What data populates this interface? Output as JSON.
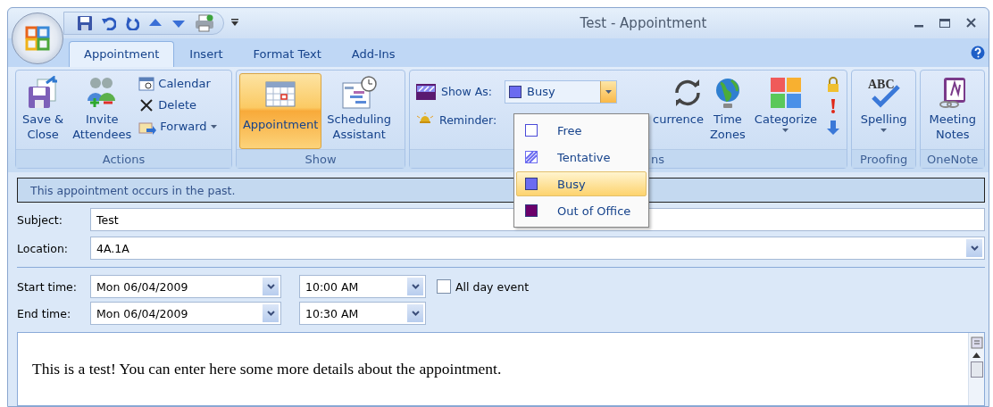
{
  "title_bar": {
    "title": "Test - Appointment"
  },
  "tabs": [
    {
      "label": "Appointment",
      "selected": true
    },
    {
      "label": "Insert",
      "selected": false
    },
    {
      "label": "Format Text",
      "selected": false
    },
    {
      "label": "Add-Ins",
      "selected": false
    }
  ],
  "ribbon": {
    "actions": {
      "label": "Actions",
      "save_close": [
        "Save &",
        "Close"
      ],
      "invite_attendees": [
        "Invite",
        "Attendees"
      ],
      "calendar": "Calendar",
      "delete": "Delete",
      "forward": "Forward"
    },
    "show": {
      "label": "Show",
      "appointment": {
        "label": "Appointment",
        "selected": true
      },
      "scheduling_assistant": [
        "Scheduling",
        "Assistant"
      ]
    },
    "options": {
      "label": "ns",
      "show_as_label": "Show As:",
      "show_as_value": "Busy",
      "reminder_label": "Reminder:",
      "recurrence": "currence",
      "time_zones": [
        "Time",
        "Zones"
      ],
      "categorize": "Categorize"
    },
    "proofing": {
      "label": "Proofing",
      "spelling": "Spelling",
      "spelling_icon_text": "ABC"
    },
    "onenote": {
      "label": "OneNote",
      "meeting_notes": [
        "Meeting",
        "Notes"
      ]
    }
  },
  "show_as_menu": [
    {
      "label": "Free",
      "kind": "outline",
      "selected": false
    },
    {
      "label": "Tentative",
      "kind": "hatched",
      "color": "#6b6bf0",
      "selected": false
    },
    {
      "label": "Busy",
      "kind": "solid",
      "color": "#6b6bf0",
      "selected": true
    },
    {
      "label": "Out of Office",
      "kind": "solid",
      "color": "#6b006b",
      "selected": false
    }
  ],
  "info_bar": "This appointment occurs in the past.",
  "subject": {
    "label": "Subject:",
    "value": "Test"
  },
  "location": {
    "label": "Location:",
    "value": "4A.1A"
  },
  "start": {
    "label": "Start time:",
    "date": "Mon 06/04/2009",
    "time": "10:00 AM"
  },
  "end": {
    "label": "End time:",
    "date": "Mon 06/04/2009",
    "time": "10:30 AM"
  },
  "all_day_event": {
    "label": "All day event",
    "checked": false
  },
  "body_text": "This is a test! You can enter here some more details about the appointment."
}
